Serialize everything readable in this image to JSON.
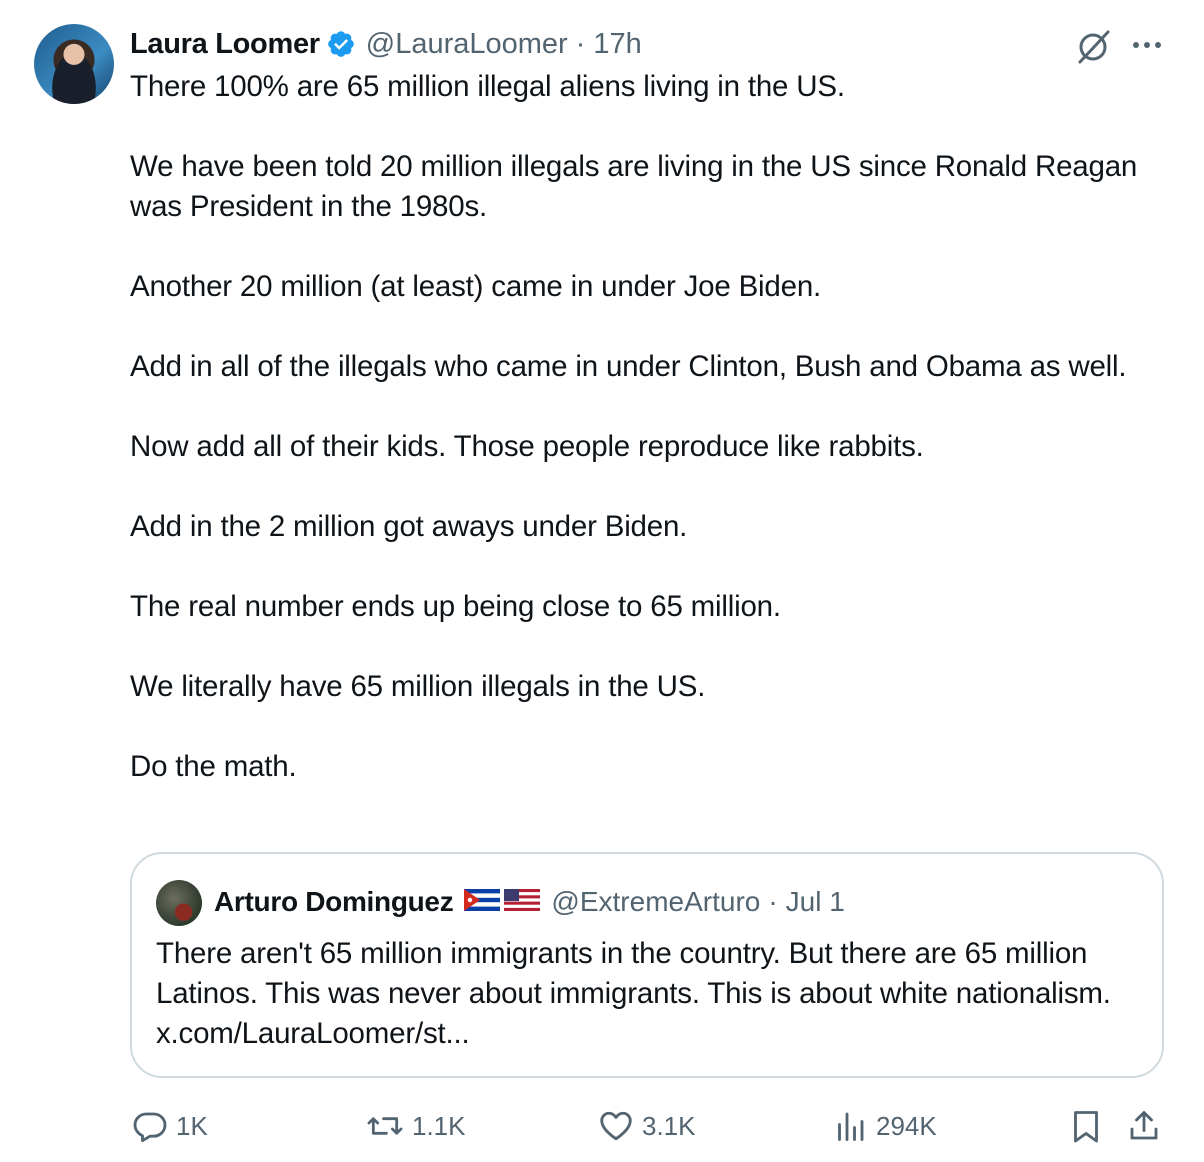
{
  "tweet": {
    "author": {
      "name": "Laura Loomer",
      "handle": "@LauraLoomer",
      "separator": "·",
      "time": "17h"
    },
    "paragraphs": [
      "There 100% are 65 million illegal aliens living in the US.",
      "We have been told 20 million illegals are living in the US since Ronald Reagan was President in the 1980s.",
      "Another 20 million (at least) came in under Joe Biden.",
      "Add in all of the illegals who came in under Clinton, Bush and Obama as well.",
      "Now add all of their kids. Those people reproduce like rabbits.",
      "Add in the 2 million got aways under Biden.",
      "The real number ends up being close to 65 million.",
      "We literally have 65 million illegals in the US.",
      "Do the math."
    ],
    "icons": {
      "verified": "verified-badge-icon",
      "grok": "grok-icon",
      "more": "more-options-icon"
    },
    "colors": {
      "verified": "#1d9bf0",
      "secondary_text": "#536471",
      "border": "#cfd9de"
    }
  },
  "quote": {
    "author": {
      "name": "Arturo Dominguez",
      "flags": "🇨🇺🇺🇸",
      "handle": "@ExtremeArturo",
      "separator": "·",
      "time": "Jul 1"
    },
    "text": "There aren't 65 million immigrants in the country. But there are 65 million Latinos. This was never about immigrants. This is about white nationalism. x.com/LauraLoomer/st..."
  },
  "actions": {
    "replies": "1K",
    "reposts": "1.1K",
    "likes": "3.1K",
    "views": "294K"
  }
}
